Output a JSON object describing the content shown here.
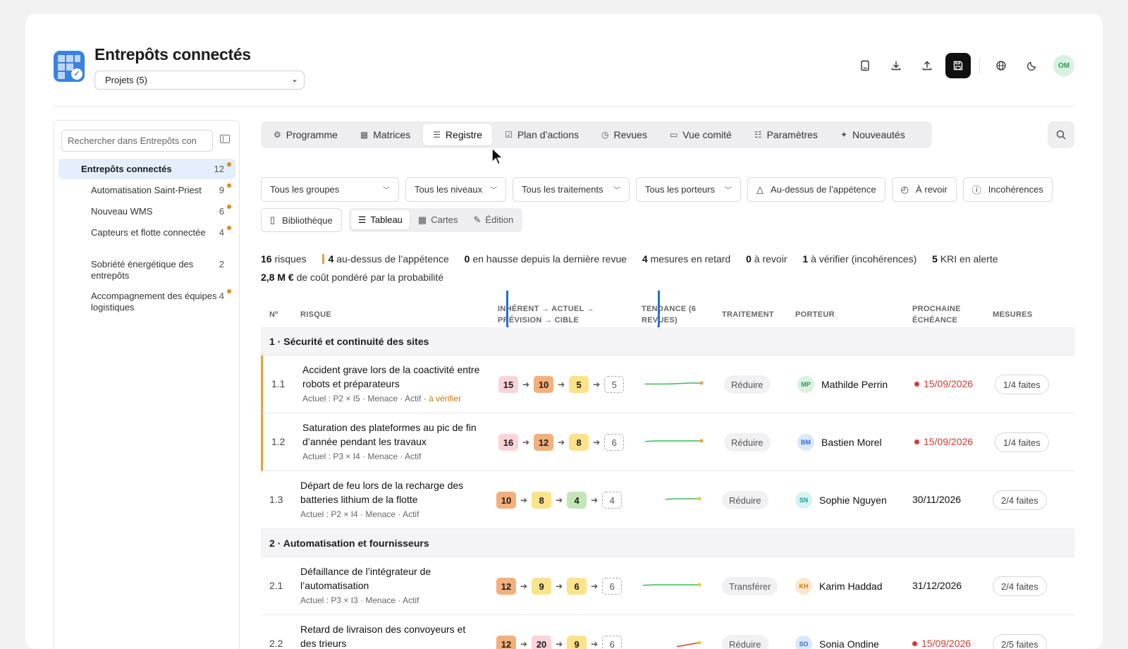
{
  "app": {
    "title": "Entrepôts connectés",
    "project_select": "Projets (5)",
    "user_initials": "OM"
  },
  "sidebar": {
    "search_placeholder": "Rechercher dans Entrepôts con",
    "items": [
      {
        "label": "Entrepôts connectés",
        "count": "12",
        "dot": true,
        "active": true
      },
      {
        "label": "Automatisation Saint-Priest",
        "count": "9",
        "dot": true
      },
      {
        "label": "Nouveau WMS",
        "count": "6",
        "dot": true
      },
      {
        "label": "Capteurs et flotte connectée",
        "count": "4",
        "dot": true
      },
      {
        "label": "Sobriété énergétique des entrepôts",
        "count": "2",
        "dot": false
      },
      {
        "label": "Accompagnement des équipes logistiques",
        "count": "4",
        "dot": true
      }
    ]
  },
  "tabs": [
    {
      "label": "Programme",
      "icon": "program-icon"
    },
    {
      "label": "Matrices",
      "icon": "grid-icon"
    },
    {
      "label": "Registre",
      "icon": "list-icon",
      "active": true
    },
    {
      "label": "Plan d’actions",
      "icon": "checkbox-icon"
    },
    {
      "label": "Revues",
      "icon": "clock-icon"
    },
    {
      "label": "Vue comité",
      "icon": "monitor-icon"
    },
    {
      "label": "Paramètres",
      "icon": "sliders-icon"
    },
    {
      "label": "Nouveautés",
      "icon": "sparkle-icon"
    }
  ],
  "filters": {
    "groups": "Tous les groupes",
    "levels": "Tous les niveaux",
    "treatments": "Tous les traitements",
    "owners": "Tous les porteurs",
    "appetite": "Au-dessus de l’appétence",
    "review": "À revoir",
    "inconsistencies": "Incohérences",
    "library": "Bibliothèque",
    "views": [
      "Tableau",
      "Cartes",
      "Édition"
    ]
  },
  "stats": {
    "risks_n": "16",
    "risks_t": "risques",
    "appetite_n": "4",
    "appetite_t": "au-dessus de l’appétence",
    "rising_n": "0",
    "rising_t": "en hausse depuis la dernière revue",
    "late_n": "4",
    "late_t": "mesures en retard",
    "review_n": "0",
    "review_t": "à revoir",
    "verify_n": "1",
    "verify_t": "à vérifier (incohérences)",
    "kri_n": "5",
    "kri_t": "KRI en alerte",
    "cost_n": "2,8 M €",
    "cost_t": "de coût pondéré par la probabilité"
  },
  "columns": {
    "num": "Nº",
    "risk": "RISQUE",
    "chain": "INHÉRENT → ACTUEL → PRÉVISION → CIBLE",
    "trend": "TENDANCE (6 REVUES)",
    "treatment": "TRAITEMENT",
    "owner": "PORTEUR",
    "due": "PROCHAINE ÉCHÉANCE",
    "measures": "MESURES"
  },
  "groups": [
    {
      "title": "1 · Sécurité et continuité des sites",
      "rows": [
        {
          "num": "1.1",
          "title": "Accident grave lors de la coactivité entre robots et préparateurs",
          "meta": "Actuel : P2 × I5 · Menace · Actif · ",
          "flag": "à vérifier",
          "scores": [
            "15",
            "10",
            "5",
            "5"
          ],
          "treatment": "Réduire",
          "owner": "Mathilde Perrin",
          "initials": "MP",
          "due": "15/09/2026",
          "late": true,
          "measures": "1/4 faites",
          "warn": true,
          "trend": [
            0.6,
            0.6,
            0.6,
            0.55,
            0.5,
            0.5
          ]
        },
        {
          "num": "1.2",
          "title": "Saturation des plateformes au pic de fin d’année pendant les travaux",
          "meta": "Actuel : P3 × I4 · Menace · Actif",
          "flag": "",
          "scores": [
            "16",
            "12",
            "8",
            "6"
          ],
          "treatment": "Réduire",
          "owner": "Bastien Morel",
          "initials": "BM",
          "due": "15/09/2026",
          "late": true,
          "measures": "1/4 faites",
          "warn": true,
          "trend": [
            0.55,
            0.5,
            0.5,
            0.5,
            0.5,
            0.5
          ]
        },
        {
          "num": "1.3",
          "title": "Départ de feu lors de la recharge des batteries lithium de la flotte",
          "meta": "Actuel : P2 × I4 · Menace · Actif",
          "flag": "",
          "scores": [
            "10",
            "8",
            "4",
            "4"
          ],
          "treatment": "Réduire",
          "owner": "Sophie Nguyen",
          "initials": "SN",
          "due": "30/11/2026",
          "late": false,
          "measures": "2/4 faites",
          "warn": false,
          "trend": [
            null,
            null,
            0.55,
            0.5,
            0.5,
            0.5
          ]
        }
      ]
    },
    {
      "title": "2 · Automatisation et fournisseurs",
      "rows": [
        {
          "num": "2.1",
          "title": "Défaillance de l’intégrateur de l’automatisation",
          "meta": "Actuel : P3 × I3 · Menace · Actif",
          "flag": "",
          "scores": [
            "12",
            "9",
            "6",
            "6"
          ],
          "treatment": "Transférer",
          "owner": "Karim Haddad",
          "initials": "KH",
          "due": "31/12/2026",
          "late": false,
          "measures": "2/4 faites",
          "warn": false,
          "trend": [
            0.55,
            0.5,
            0.5,
            0.5,
            0.5,
            0.5
          ]
        },
        {
          "num": "2.2",
          "title": "Retard de livraison des convoyeurs et des trieurs",
          "meta": "",
          "flag": "",
          "scores": [
            "12",
            "20",
            "9",
            "6"
          ],
          "treatment": "Réduire",
          "owner": "Sonia Ondine",
          "initials": "SO",
          "due": "15/09/2026",
          "late": true,
          "measures": "2/5 faites",
          "warn": false,
          "trend": [
            null,
            null,
            null,
            0.9,
            0.7,
            0.5
          ]
        }
      ]
    }
  ]
}
